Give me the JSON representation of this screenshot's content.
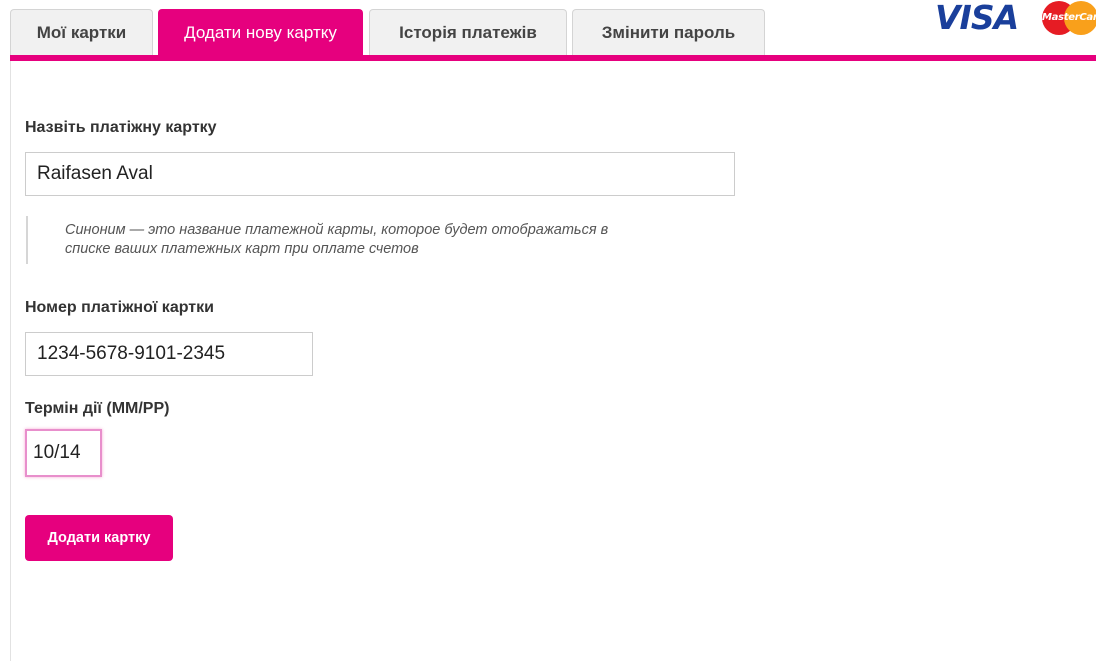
{
  "tabs": [
    {
      "label": "Мої картки",
      "active": false
    },
    {
      "label": "Додати нову картку",
      "active": true
    },
    {
      "label": "Історія платежів",
      "active": false
    },
    {
      "label": "Змінити пароль",
      "active": false
    }
  ],
  "logos": {
    "visa": "VISA",
    "mastercard": "MasterCard"
  },
  "form": {
    "name_label": "Назвіть платіжну картку",
    "name_value": "Raifasen Aval",
    "hint_line1": "Синоним — это название платежной карты, которое будет отображаться в",
    "hint_line2": "списке ваших платежных карт при оплате счетов",
    "number_label": "Номер платіжної картки",
    "number_value": "1234-5678-9101-2345",
    "expiry_label": "Термін дії (ММ/РР)",
    "expiry_value": "10/14",
    "submit_label": "Додати картку"
  },
  "colors": {
    "accent": "#e6007e",
    "tab_inactive_bg": "#f1f1f1",
    "visa_blue": "#1a3f9b"
  }
}
